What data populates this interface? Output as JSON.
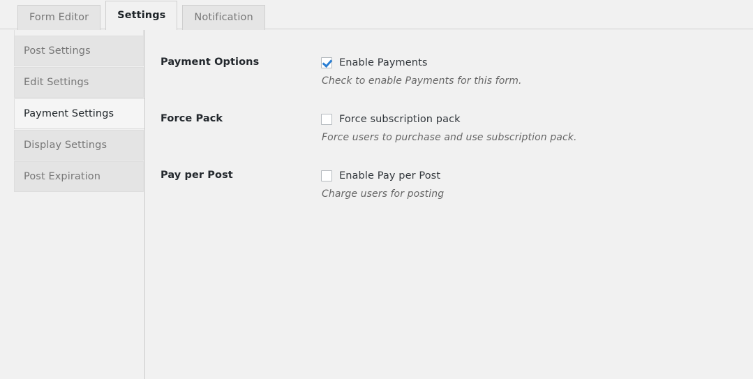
{
  "tabs": [
    {
      "label": "Form Editor",
      "active": false
    },
    {
      "label": "Settings",
      "active": true
    },
    {
      "label": "Notification",
      "active": false
    }
  ],
  "sidebar": {
    "items": [
      {
        "label": "Post Settings",
        "active": false
      },
      {
        "label": "Edit Settings",
        "active": false
      },
      {
        "label": "Payment Settings",
        "active": true
      },
      {
        "label": "Display Settings",
        "active": false
      },
      {
        "label": "Post Expiration",
        "active": false
      }
    ]
  },
  "settings": {
    "rows": [
      {
        "label": "Payment Options",
        "checkbox_label": "Enable Payments",
        "checked": true,
        "description": "Check to enable Payments for this form."
      },
      {
        "label": "Force Pack",
        "checkbox_label": "Force subscription pack",
        "checked": false,
        "description": "Force users to purchase and use subscription pack."
      },
      {
        "label": "Pay per Post",
        "checkbox_label": "Enable Pay per Post",
        "checked": false,
        "description": "Charge users for posting"
      }
    ]
  },
  "colors": {
    "page_background": "#f1f1f1",
    "tab_inactive_background": "#e5e5e5",
    "tab_active_background": "#f1f1f1",
    "sidebar_item_background": "#e4e4e4",
    "sidebar_item_active_background": "#f5f5f5",
    "border": "#dddddd",
    "divider": "#c9c9c9",
    "checkmark_blue": "#2a7ed3",
    "text_dark": "#23282d",
    "text_muted": "#777777",
    "text_description": "#666666"
  }
}
